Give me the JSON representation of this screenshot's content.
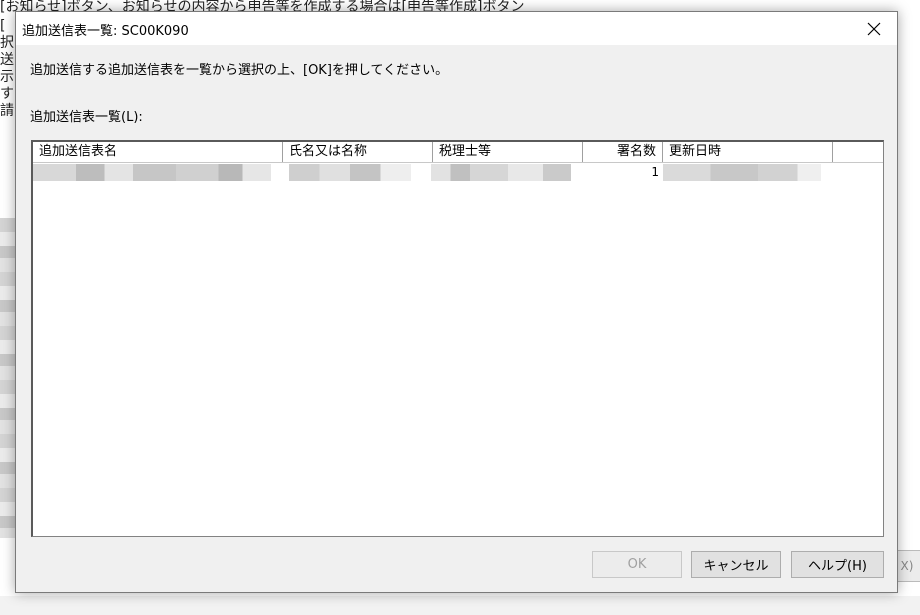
{
  "background_app": {
    "top_text": "[お知らせ]ボタン、お知らせの内容から申告等を作成する場合は[申告等作成]ボタン",
    "left_fragments": [
      "[",
      "択",
      "送",
      "示",
      "す",
      "請"
    ],
    "right_button_label": "X)"
  },
  "dialog": {
    "title": "追加送信表一覧: SC00K090",
    "instruction": "追加送信する追加送信表を一覧から選択の上、[OK]を押してください。",
    "list_label": "追加送信表一覧(L):",
    "columns": [
      {
        "label": "追加送信表名"
      },
      {
        "label": "氏名又は名称"
      },
      {
        "label": "税理士等"
      },
      {
        "label": "署名数"
      },
      {
        "label": "更新日時"
      },
      {
        "label": ""
      }
    ],
    "rows": [
      {
        "signature_count": "1"
      }
    ],
    "buttons": {
      "ok": "OK",
      "cancel": "キャンセル",
      "help": "ヘルプ(H)"
    }
  }
}
